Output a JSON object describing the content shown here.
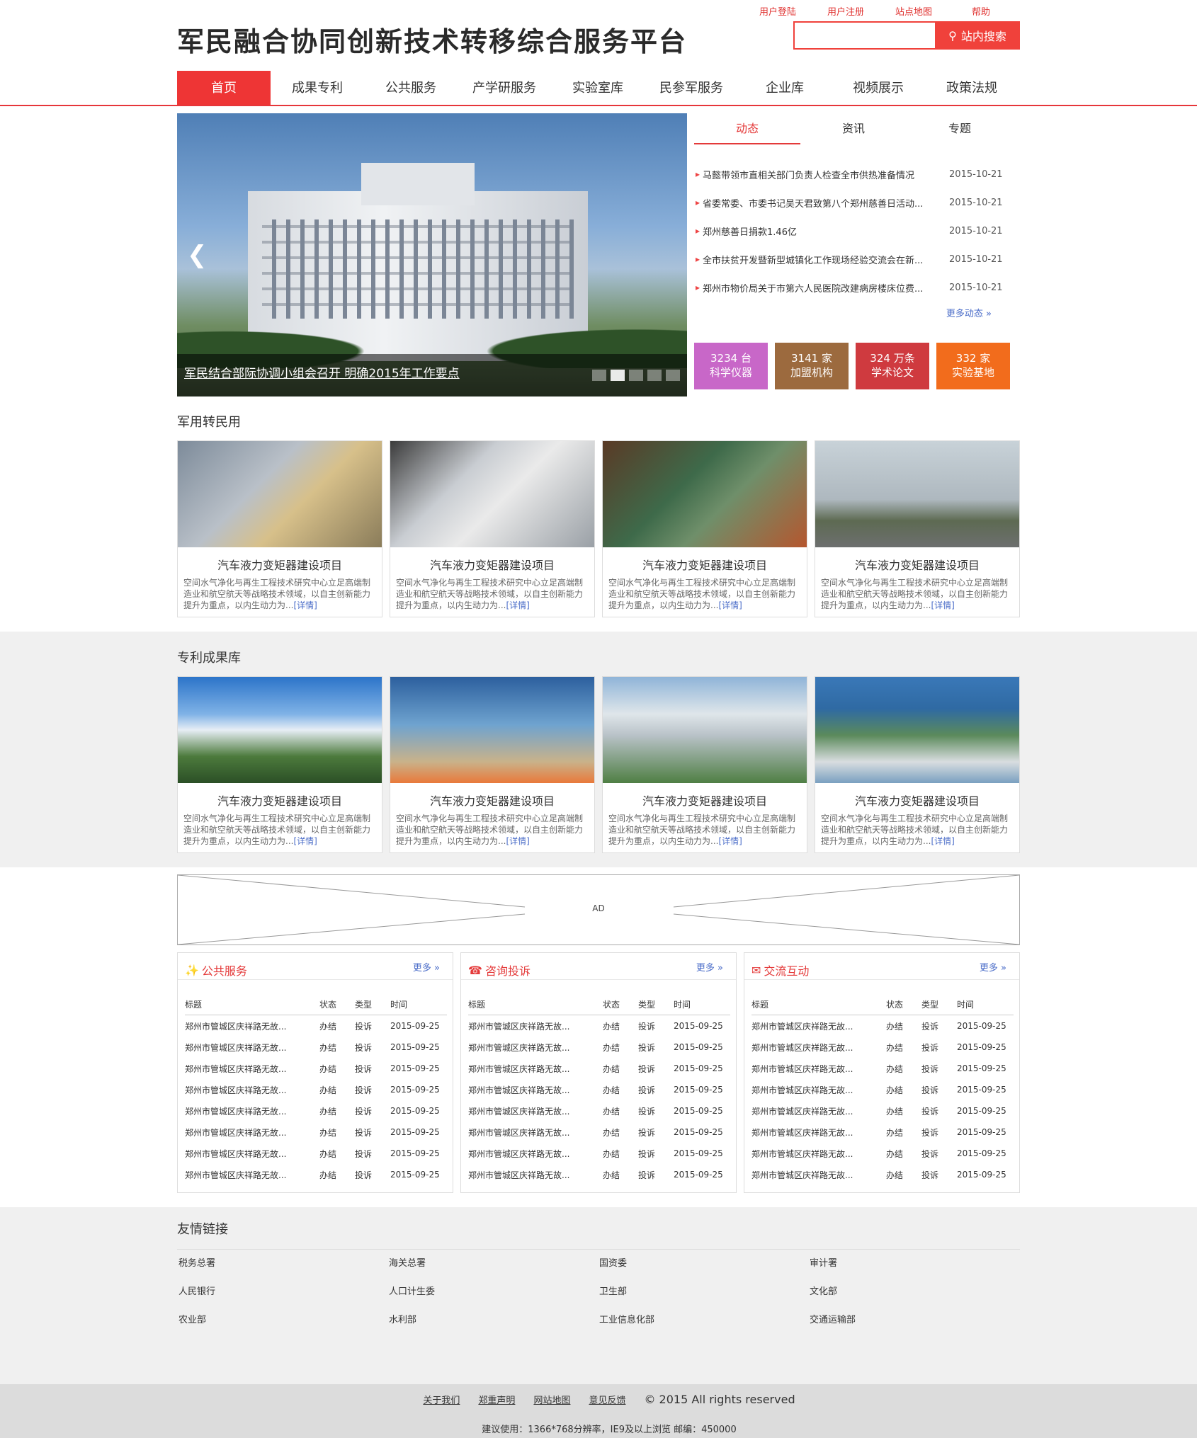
{
  "header": {
    "title": "军民融合协同创新技术转移综合服务平台",
    "toplinks": [
      "用户登陆",
      "用户注册",
      "站点地图",
      "帮助"
    ],
    "search_placeholder": "",
    "search_button": "站内搜索"
  },
  "nav": [
    "首页",
    "成果专利",
    "公共服务",
    "产学研服务",
    "实验室库",
    "民参军服务",
    "企业库",
    "视频展示",
    "政策法规"
  ],
  "slider": {
    "caption": "军民结合部际协调小组会召开 明确2015年工作要点",
    "dots": 5,
    "active_dot": 2
  },
  "news": {
    "tabs": [
      "动态",
      "资讯",
      "专题"
    ],
    "items": [
      {
        "title": "马懿带领市直相关部门负责人检查全市供热准备情况",
        "date": "2015-10-21"
      },
      {
        "title": "省委常委、市委书记吴天君致第八个郑州慈善日活动...",
        "date": "2015-10-21"
      },
      {
        "title": "郑州慈善日捐款1.46亿",
        "date": "2015-10-21"
      },
      {
        "title": "全市扶贫开发暨新型城镇化工作现场经验交流会在新...",
        "date": "2015-10-21"
      },
      {
        "title": "郑州市物价局关于市第六人民医院改建病房楼床位费...",
        "date": "2015-10-21"
      }
    ],
    "more": "更多动态 »"
  },
  "stats": [
    {
      "num": "3234 台",
      "label": "科学仪器",
      "color": "#c867c8"
    },
    {
      "num": "3141 家",
      "label": "加盟机构",
      "color": "#9c6a3e"
    },
    {
      "num": "324 万条",
      "label": "学术论文",
      "color": "#cf3a3f"
    },
    {
      "num": "332 家",
      "label": "实验基地",
      "color": "#f26c1c"
    }
  ],
  "section1": {
    "title": "军用转民用",
    "cards": [
      {
        "title": "汽车液力变矩器建设项目",
        "desc": "空间水气净化与再生工程技术研究中心立足高端制造业和航空航天等战略技术领域，以自主创新能力提升为重点，以内生动力为...",
        "link": "[详情]"
      },
      {
        "title": "汽车液力变矩器建设项目",
        "desc": "空间水气净化与再生工程技术研究中心立足高端制造业和航空航天等战略技术领域，以自主创新能力提升为重点，以内生动力为...",
        "link": "[详情]"
      },
      {
        "title": "汽车液力变矩器建设项目",
        "desc": "空间水气净化与再生工程技术研究中心立足高端制造业和航空航天等战略技术领域，以自主创新能力提升为重点，以内生动力为...",
        "link": "[详情]"
      },
      {
        "title": "汽车液力变矩器建设项目",
        "desc": "空间水气净化与再生工程技术研究中心立足高端制造业和航空航天等战略技术领域，以自主创新能力提升为重点，以内生动力为...",
        "link": "[详情]"
      }
    ]
  },
  "section2": {
    "title": "专利成果库",
    "cards": [
      {
        "title": "汽车液力变矩器建设项目",
        "desc": "空间水气净化与再生工程技术研究中心立足高端制造业和航空航天等战略技术领域，以自主创新能力提升为重点，以内生动力为...",
        "link": "[详情]"
      },
      {
        "title": "汽车液力变矩器建设项目",
        "desc": "空间水气净化与再生工程技术研究中心立足高端制造业和航空航天等战略技术领域，以自主创新能力提升为重点，以内生动力为...",
        "link": "[详情]"
      },
      {
        "title": "汽车液力变矩器建设项目",
        "desc": "空间水气净化与再生工程技术研究中心立足高端制造业和航空航天等战略技术领域，以自主创新能力提升为重点，以内生动力为...",
        "link": "[详情]"
      },
      {
        "title": "汽车液力变矩器建设项目",
        "desc": "空间水气净化与再生工程技术研究中心立足高端制造业和航空航天等战略技术领域，以自主创新能力提升为重点，以内生动力为...",
        "link": "[详情]"
      }
    ]
  },
  "ad": {
    "label": "AD"
  },
  "panels": [
    {
      "title": "公共服务",
      "icon": "person-icon",
      "more": "更多 »"
    },
    {
      "title": "咨询投诉",
      "icon": "phone-icon",
      "more": "更多 »"
    },
    {
      "title": "交流互动",
      "icon": "chat-icon",
      "more": "更多 »"
    }
  ],
  "panel_table": {
    "headers": [
      "标题",
      "状态",
      "类型",
      "时间"
    ],
    "rows": [
      [
        "郑州市管城区庆祥路无故...",
        "办结",
        "投诉",
        "2015-09-25"
      ],
      [
        "郑州市管城区庆祥路无故...",
        "办结",
        "投诉",
        "2015-09-25"
      ],
      [
        "郑州市管城区庆祥路无故...",
        "办结",
        "投诉",
        "2015-09-25"
      ],
      [
        "郑州市管城区庆祥路无故...",
        "办结",
        "投诉",
        "2015-09-25"
      ],
      [
        "郑州市管城区庆祥路无故...",
        "办结",
        "投诉",
        "2015-09-25"
      ],
      [
        "郑州市管城区庆祥路无故...",
        "办结",
        "投诉",
        "2015-09-25"
      ],
      [
        "郑州市管城区庆祥路无故...",
        "办结",
        "投诉",
        "2015-09-25"
      ],
      [
        "郑州市管城区庆祥路无故...",
        "办结",
        "投诉",
        "2015-09-25"
      ]
    ]
  },
  "friends": {
    "title": "友情链接",
    "links": [
      "税务总署",
      "海关总署",
      "国资委",
      "审计署",
      "人民银行",
      "人口计生委",
      "卫生部",
      "文化部",
      "农业部",
      "水利部",
      "工业信息化部",
      "交通运输部"
    ]
  },
  "footer": {
    "links": [
      "关于我们",
      "郑重声明",
      "网站地图",
      "意见反馈"
    ],
    "copyright": "© 2015 All rights reserved",
    "note": "建议使用：1366*768分辨率，IE9及以上浏览  邮编：450000"
  }
}
